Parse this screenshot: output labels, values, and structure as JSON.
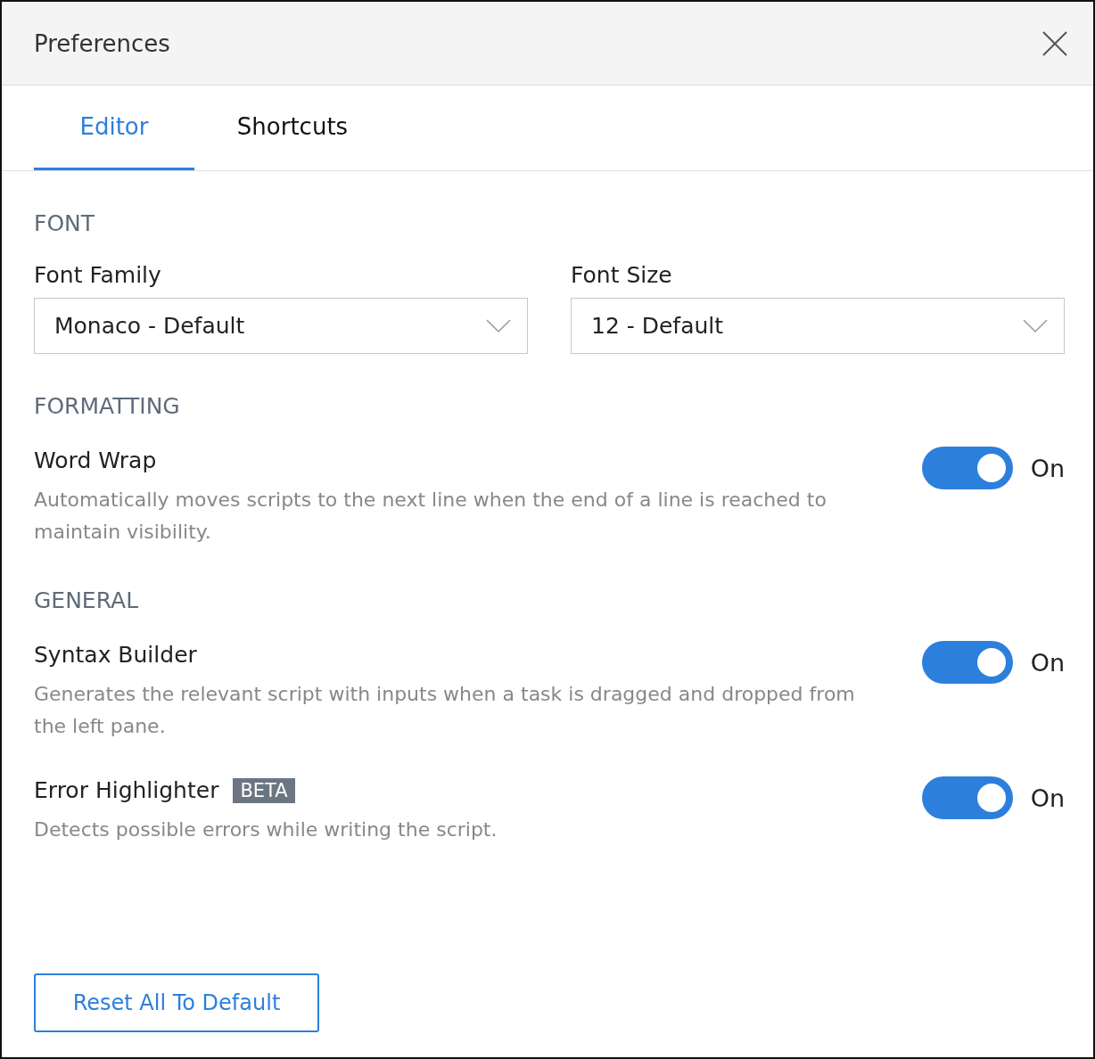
{
  "dialog": {
    "title": "Preferences"
  },
  "tabs": [
    {
      "label": "Editor",
      "selected": true
    },
    {
      "label": "Shortcuts",
      "selected": false
    }
  ],
  "sections": [
    {
      "heading": "FONT",
      "kind": "selects",
      "fields": [
        {
          "label": "Font Family",
          "value": "Monaco - Default"
        },
        {
          "label": "Font Size",
          "value": "12 - Default"
        }
      ]
    },
    {
      "heading": "FORMATTING",
      "kind": "toggles",
      "settings": [
        {
          "title": "Word Wrap",
          "description": "Automatically moves scripts to the next line when the end of a line is reached to maintain visibility.",
          "on": true,
          "state_label": "On"
        }
      ]
    },
    {
      "heading": "GENERAL",
      "kind": "toggles",
      "settings": [
        {
          "title": "Syntax Builder",
          "description": "Generates the relevant script with inputs when a task is dragged and dropped from the left pane.",
          "on": true,
          "state_label": "On"
        },
        {
          "title": "Error Highlighter",
          "badge": "BETA",
          "description": "Detects possible errors while writing the script.",
          "on": true,
          "state_label": "On"
        }
      ]
    }
  ],
  "reset_button": "Reset All To Default"
}
